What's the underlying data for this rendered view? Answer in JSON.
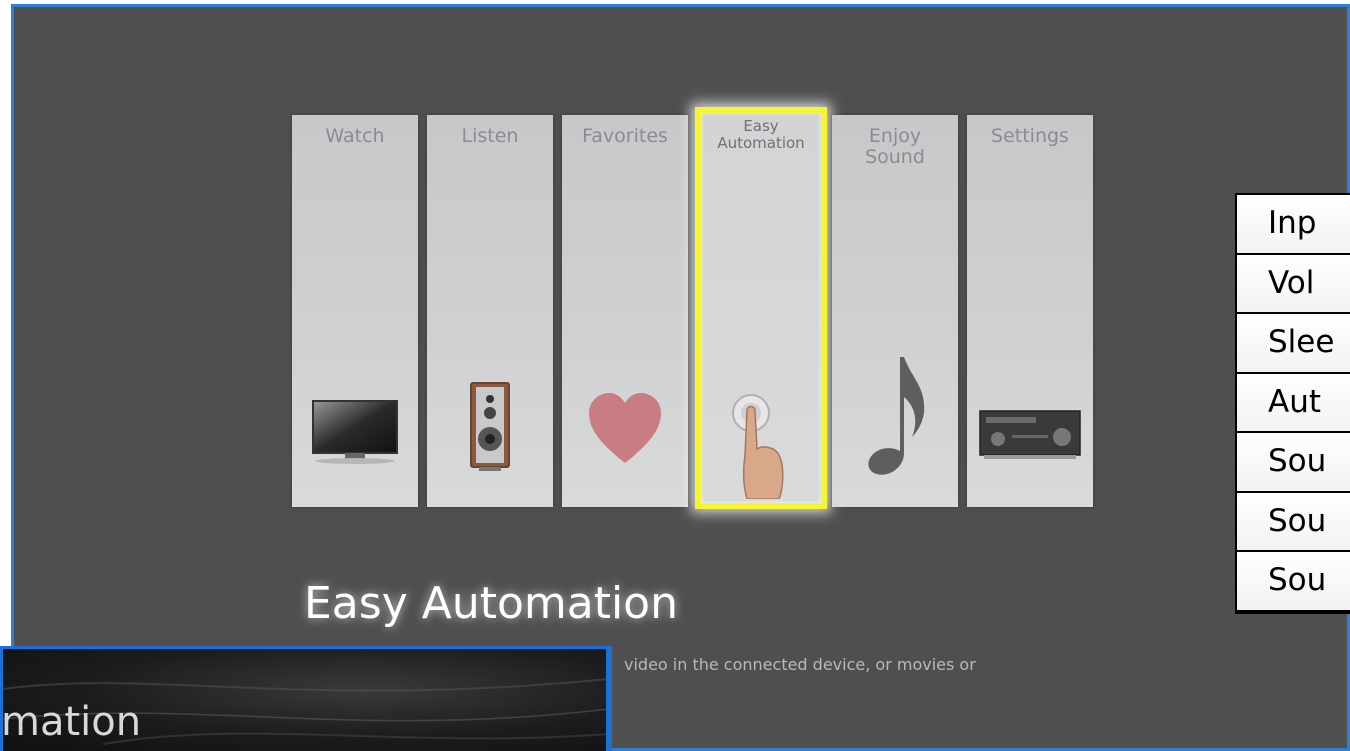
{
  "home_menu": {
    "tiles": [
      {
        "label": "Watch",
        "icon": "tv-icon"
      },
      {
        "label": "Listen",
        "icon": "speaker-icon"
      },
      {
        "label": "Favorites",
        "icon": "heart-icon"
      },
      {
        "label": "Easy\nAutomation",
        "icon": "finger-press-button-icon",
        "selected": true
      },
      {
        "label": "Enjoy\nSound",
        "icon": "music-note-icon"
      },
      {
        "label": "Settings",
        "icon": "av-receiver-icon"
      }
    ],
    "selected_title": "Easy Automation",
    "description_visible": "video in the connected device, or movies or"
  },
  "popup": {
    "title_fragment": "mation"
  },
  "side_menu": {
    "items": [
      "Inp",
      "Vol",
      "Slee",
      "Aut",
      "Sou",
      "Sou",
      "Sou"
    ]
  },
  "colors": {
    "screen_bg": "#4f4f4f",
    "highlight": "#f6f535",
    "frame_blue": "#2f7fd4"
  }
}
